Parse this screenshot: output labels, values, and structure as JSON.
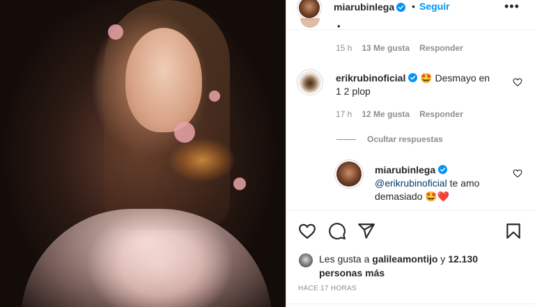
{
  "post": {
    "username": "miarubinlega",
    "follow_label": "Seguir",
    "dot": "•",
    "more_label": "•••"
  },
  "partial_comment": {
    "glyph": "•",
    "time": "15 h",
    "likes": "13 Me gusta",
    "reply": "Responder"
  },
  "comment1": {
    "username": "erikrubinoficial",
    "text": "Desmayo en 1 2 plop",
    "emoji": "🤩",
    "time": "17 h",
    "likes": "12 Me gusta",
    "reply": "Responder"
  },
  "replies_toggle": "Ocultar respuestas",
  "comment2": {
    "username": "miarubinlega",
    "mention": "@erikrubinoficial",
    "text_after": " te amo demasiado",
    "emojis": "🤩❤️"
  },
  "likes": {
    "prefix": "Les gusta a",
    "user": "galileamontijo",
    "middle": "y",
    "others": "12.130 personas más"
  },
  "timestamp": "HACE 17 HORAS",
  "colors": {
    "accent": "#0095f6",
    "verified": "#0095f6",
    "secondary_text": "#8e8e8e",
    "mention": "#00376b"
  },
  "icons": [
    "heart-icon",
    "comment-icon",
    "share-icon",
    "bookmark-icon",
    "more-icon",
    "verified-icon"
  ]
}
